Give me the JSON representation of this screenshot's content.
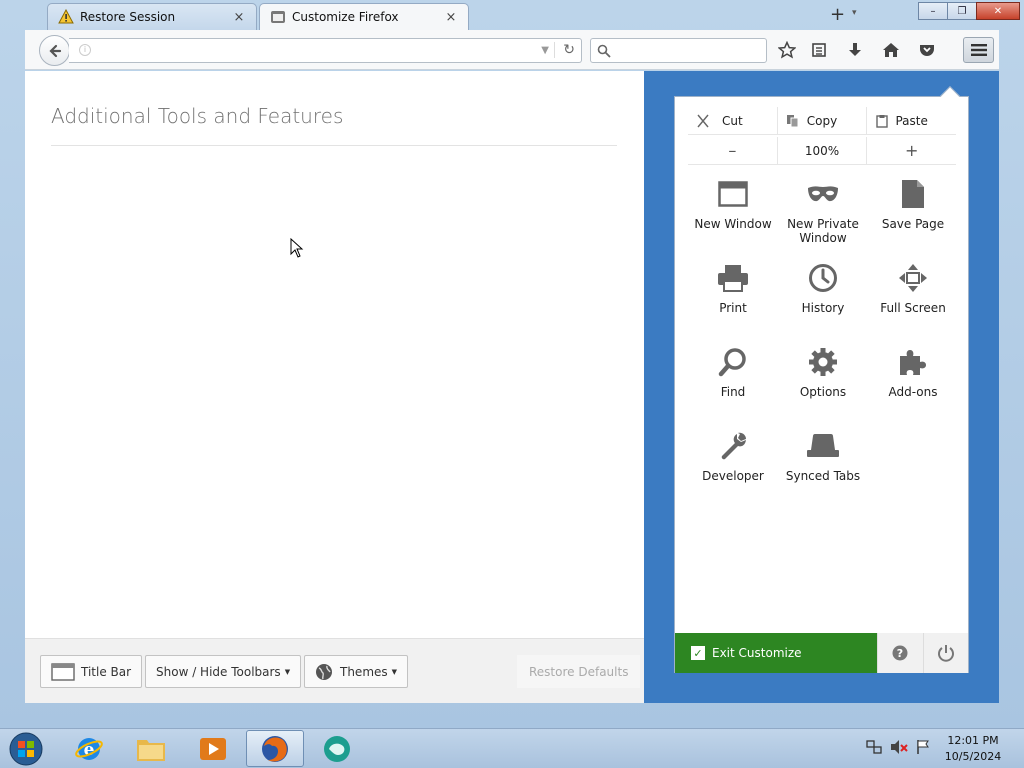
{
  "tabs": [
    {
      "label": "Restore Session",
      "icon": "warning-icon",
      "close": "×"
    },
    {
      "label": "Customize Firefox",
      "icon": "customize-icon",
      "close": "×"
    }
  ],
  "tabstrip": {
    "new_tab": "+",
    "tab_list": "▾"
  },
  "window_controls": {
    "minimize": "–",
    "restore": "❐",
    "close": "✕"
  },
  "navbar": {
    "url_value": "",
    "search_placeholder": "",
    "icons": [
      "back-icon",
      "identity-icon",
      "reload-icon",
      "search-icon",
      "bookmark-star-icon",
      "reading-list-icon",
      "download-icon",
      "home-icon",
      "pocket-icon",
      "menu-icon"
    ]
  },
  "content": {
    "title": "Additional Tools and Features"
  },
  "footer": {
    "title_bar": "Title Bar",
    "show_hide_toolbars": "Show / Hide Toolbars",
    "themes": "Themes",
    "restore_defaults": "Restore Defaults"
  },
  "panel": {
    "edit": {
      "cut": "Cut",
      "copy": "Copy",
      "paste": "Paste"
    },
    "zoom": {
      "minus": "–",
      "level": "100%",
      "plus": "+"
    },
    "items": [
      {
        "label": "New Window",
        "icon": "new-window-icon"
      },
      {
        "label": "New Private Window",
        "icon": "private-mask-icon"
      },
      {
        "label": "Save Page",
        "icon": "save-page-icon"
      },
      {
        "label": "Print",
        "icon": "print-icon"
      },
      {
        "label": "History",
        "icon": "history-clock-icon"
      },
      {
        "label": "Full Screen",
        "icon": "fullscreen-icon"
      },
      {
        "label": "Find",
        "icon": "find-icon"
      },
      {
        "label": "Options",
        "icon": "options-gear-icon"
      },
      {
        "label": "Add-ons",
        "icon": "addons-puzzle-icon"
      },
      {
        "label": "Developer",
        "icon": "developer-wrench-icon"
      },
      {
        "label": "Synced Tabs",
        "icon": "synced-tabs-icon"
      }
    ],
    "exit_customize": "Exit Customize",
    "help": "?",
    "checkmark": "✓"
  },
  "taskbar": {
    "apps": [
      "start-orb-icon",
      "internet-explorer-icon",
      "file-explorer-icon",
      "media-player-icon",
      "firefox-icon",
      "app-icon"
    ],
    "clock_time": "12:01 PM",
    "clock_date": "10/5/2024"
  },
  "colors": {
    "panel_bg": "#3b7bc2",
    "exit_green": "#2d8622"
  }
}
